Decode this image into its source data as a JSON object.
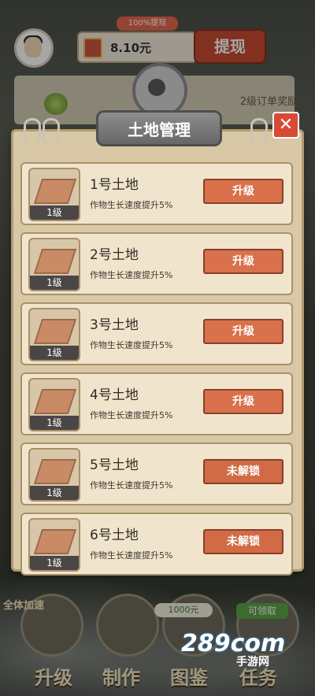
{
  "header": {
    "cash_tag": "100%提现",
    "cash_value": "8.10元",
    "withdraw_label": "提现"
  },
  "order": {
    "reward_text": "2级订单奖励"
  },
  "modal": {
    "title": "土地管理",
    "close_label": "✕",
    "plots": [
      {
        "name": "1号土地",
        "level": "1级",
        "desc": "作物生长速度提升5%",
        "action": "升级"
      },
      {
        "name": "2号土地",
        "level": "1级",
        "desc": "作物生长速度提升5%",
        "action": "升级"
      },
      {
        "name": "3号土地",
        "level": "1级",
        "desc": "作物生长速度提升5%",
        "action": "升级"
      },
      {
        "name": "4号土地",
        "level": "1级",
        "desc": "作物生长速度提升5%",
        "action": "升级"
      },
      {
        "name": "5号土地",
        "level": "1级",
        "desc": "作物生长速度提升5%",
        "action": "未解锁"
      },
      {
        "name": "6号土地",
        "level": "1级",
        "desc": "作物生长速度提升5%",
        "action": "未解锁"
      }
    ]
  },
  "bottom": {
    "speed_label": "全体加速",
    "msg_badge": "1000元",
    "claim_badge": "可领取",
    "nav": [
      "升级",
      "制作",
      "图鉴",
      "任务"
    ]
  },
  "watermark": {
    "main": "289com",
    "sub": "手游网"
  },
  "colors": {
    "accent_button": "#d8714c",
    "withdraw_button": "#c84a32",
    "close_button": "#d84a34",
    "card_bg": "#f0e5cc"
  }
}
